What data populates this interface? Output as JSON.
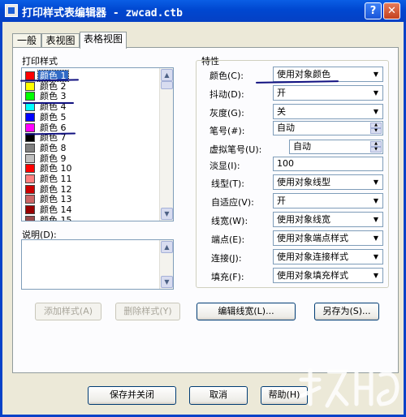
{
  "window": {
    "title": "打印样式表编辑器 - zwcad.ctb",
    "help_button": "?",
    "close_button": "✕"
  },
  "tabs": [
    {
      "label": "一般"
    },
    {
      "label": "表视图"
    },
    {
      "label": "表格视图"
    }
  ],
  "styles_panel": {
    "label": "打印样式",
    "items": [
      {
        "label": "颜色 1",
        "color": "#ff0000"
      },
      {
        "label": "颜色 2",
        "color": "#ffff00"
      },
      {
        "label": "颜色 3",
        "color": "#00ff00"
      },
      {
        "label": "颜色 4",
        "color": "#00ffff"
      },
      {
        "label": "颜色 5",
        "color": "#0000ff"
      },
      {
        "label": "颜色 6",
        "color": "#ff00ff"
      },
      {
        "label": "颜色 7",
        "color": "#000000"
      },
      {
        "label": "颜色 8",
        "color": "#808080"
      },
      {
        "label": "颜色 9",
        "color": "#c0c0c0"
      },
      {
        "label": "颜色 10",
        "color": "#ff0000"
      },
      {
        "label": "颜色 11",
        "color": "#ff7f7f"
      },
      {
        "label": "颜色 12",
        "color": "#cc0000"
      },
      {
        "label": "颜色 13",
        "color": "#cc6666"
      },
      {
        "label": "颜色 14",
        "color": "#990000"
      },
      {
        "label": "颜色 15",
        "color": "#994c4c"
      }
    ],
    "description_label": "说明(D):",
    "add_style_button": "添加样式(A)",
    "delete_style_button": "删除样式(Y)"
  },
  "properties": {
    "label": "特性",
    "color": {
      "label": "颜色(C):",
      "value": "使用对象颜色"
    },
    "dither": {
      "label": "抖动(D):",
      "value": "开"
    },
    "grayscale": {
      "label": "灰度(G):",
      "value": "关"
    },
    "pen_number": {
      "label": "笔号(#):",
      "value": "自动"
    },
    "virtual_pen": {
      "label": "虚拟笔号(U):",
      "value": "自动"
    },
    "screening": {
      "label": "淡显(I):",
      "value": "100"
    },
    "linetype": {
      "label": "线型(T):",
      "value": "使用对象线型"
    },
    "adaptive": {
      "label": "自适应(V):",
      "value": "开"
    },
    "lineweight": {
      "label": "线宽(W):",
      "value": "使用对象线宽"
    },
    "line_end": {
      "label": "端点(E):",
      "value": "使用对象端点样式"
    },
    "line_join": {
      "label": "连接(J):",
      "value": "使用对象连接样式"
    },
    "fill": {
      "label": "填充(F):",
      "value": "使用对象填充样式"
    },
    "edit_lineweights_button": "编辑线宽(L)...",
    "save_as_button": "另存为(S)..."
  },
  "footer": {
    "save_close_button": "保存并关闭",
    "cancel_button": "取消",
    "help_button": "帮助(H)"
  },
  "colors": {
    "titlebar": "#0a5ee5",
    "selection": "#316ac5",
    "annotation": "#101080"
  }
}
